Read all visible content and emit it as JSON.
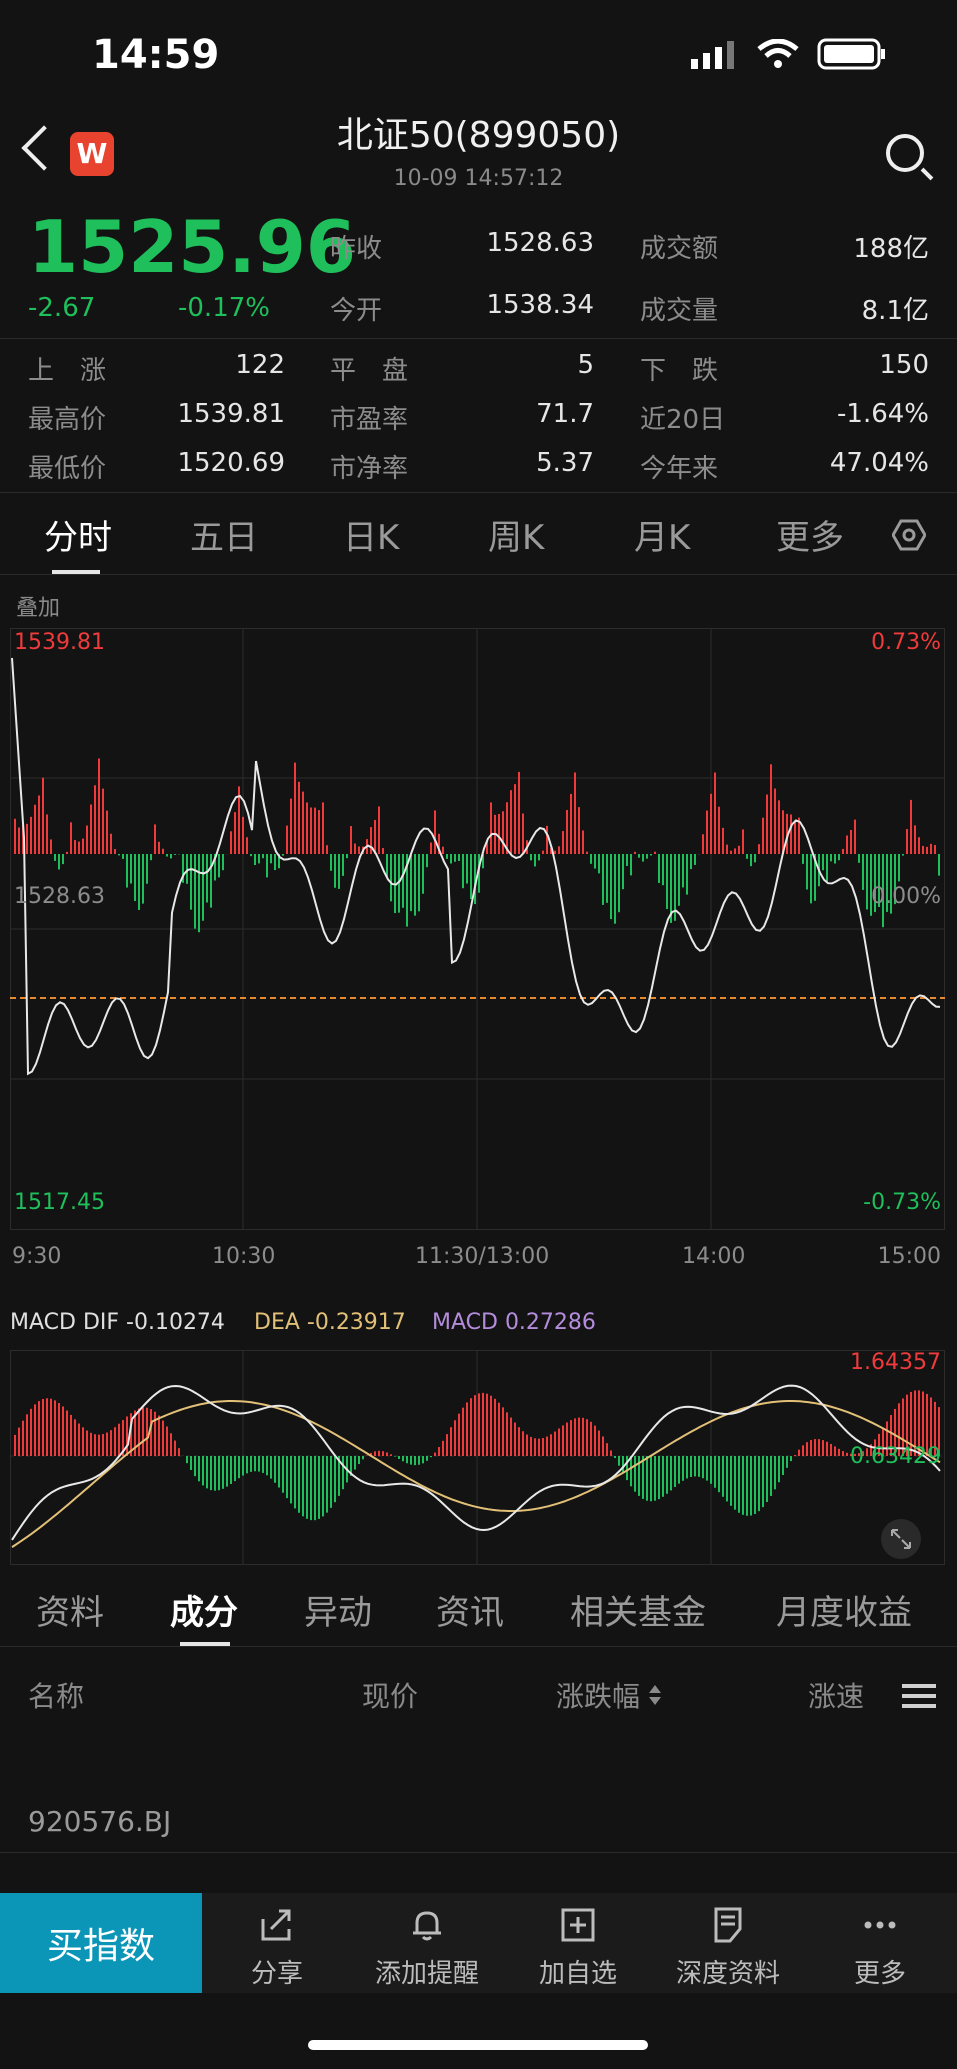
{
  "status": {
    "time": "14:59"
  },
  "nav": {
    "title": "北证50(899050)",
    "subtitle": "10-09 14:57:12",
    "logo_letter": "W"
  },
  "quote": {
    "price": "1525.96",
    "change": "-2.67",
    "change_pct": "-0.17%",
    "prev_close_label": "昨收",
    "prev_close": "1528.63",
    "turnover_label": "成交额",
    "turnover": "188亿",
    "open_label": "今开",
    "open": "1538.34",
    "volume_label": "成交量",
    "volume": "8.1亿",
    "up_label": "上　涨",
    "up": "122",
    "flat_label": "平　盘",
    "flat": "5",
    "down_label": "下　跌",
    "down": "150",
    "high_label": "最高价",
    "high": "1539.81",
    "pe_label": "市盈率",
    "pe": "71.7",
    "d20_label": "近20日",
    "d20": "-1.64%",
    "low_label": "最低价",
    "low": "1520.69",
    "pb_label": "市净率",
    "pb": "5.37",
    "ytd_label": "今年来",
    "ytd": "47.04%"
  },
  "tabs": [
    "分时",
    "五日",
    "日K",
    "周K",
    "月K",
    "更多"
  ],
  "overlay_label": "叠加",
  "intraday": {
    "top_price": "1539.81",
    "top_pct": "0.73%",
    "mid_price": "1528.63",
    "mid_pct": "0.00%",
    "bottom_price": "1517.45",
    "bottom_pct": "-0.73%",
    "times": [
      "9:30",
      "10:30",
      "11:30/13:00",
      "14:00",
      "15:00"
    ],
    "colors": {
      "up": "#ef3b3b",
      "down": "#1fbf5b",
      "avg": "#e68a2e",
      "line": "#e8e8e8"
    }
  },
  "macd": {
    "dif_label": "MACD DIF -0.10274",
    "dea_label": "DEA -0.23917",
    "macd_label": "MACD 0.27286",
    "top": "1.64357",
    "right_val": "0.63429",
    "colors": {
      "dea": "#e2c077",
      "macd": "#b48cdc"
    }
  },
  "subtabs": [
    "资料",
    "成分",
    "异动",
    "资讯",
    "相关基金",
    "月度收益"
  ],
  "table": {
    "headers": [
      "名称",
      "现价",
      "涨跌幅",
      "涨速"
    ],
    "rows": [
      {
        "name": "920576.BJ"
      }
    ]
  },
  "bottom": {
    "buy": "买指数",
    "items": [
      "分享",
      "添加提醒",
      "加自选",
      "深度资料",
      "更多"
    ]
  }
}
